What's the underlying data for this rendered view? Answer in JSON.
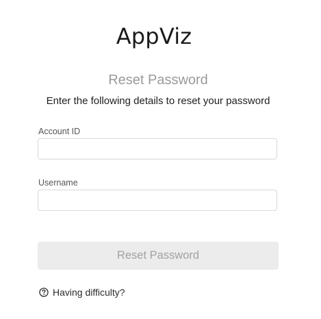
{
  "app": {
    "title": "AppViz"
  },
  "form": {
    "heading": "Reset Password",
    "subheading": "Enter the following details to reset your password",
    "fields": [
      {
        "label": "Account ID",
        "value": "",
        "placeholder": ""
      },
      {
        "label": "Username",
        "value": "",
        "placeholder": ""
      }
    ],
    "submit_label": "Reset Password",
    "help_link": "Having difficulty?",
    "help_icon": "question-circle-icon"
  },
  "colors": {
    "heading": "#9a9a9a",
    "button_bg": "#ececec",
    "button_text": "#a2a2a2",
    "input_border": "#d8d8d8"
  }
}
